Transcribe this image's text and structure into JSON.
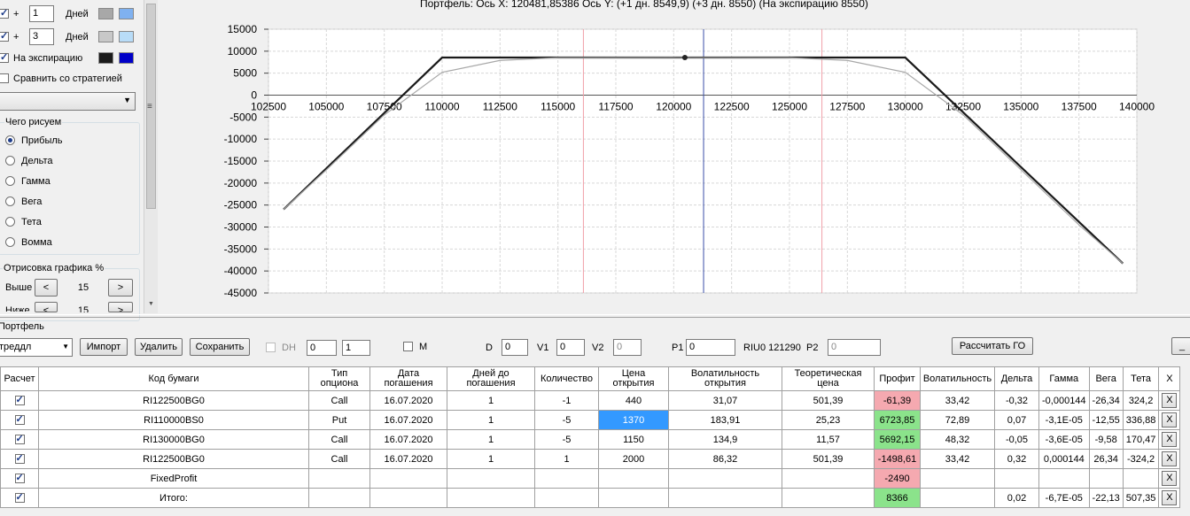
{
  "chart_title": "Портфель: Ось X: 120481,85386 Ось Y: (+1 дн. 8549,9) (+3 дн. 8550) (На экспирацию 8550)",
  "left_panel": {
    "rows": [
      {
        "prefix": "+",
        "value": "1",
        "unit": "Дней",
        "colors": [
          "#a8a8a8",
          "#7fb1f0"
        ]
      },
      {
        "prefix": "+",
        "value": "3",
        "unit": "Дней",
        "colors": [
          "#c8c8c8",
          "#b8dcf8"
        ]
      }
    ],
    "expiry_label": "На экспирацию",
    "expiry_colors": [
      "#1a1a1a",
      "#0000c8"
    ],
    "compare_label": "Сравнить со стратегией",
    "draw_group_title": "Чего рисуем",
    "draw_options": [
      "Прибыль",
      "Дельта",
      "Гамма",
      "Вега",
      "Тета",
      "Вомма"
    ],
    "selected_option": "Прибыль",
    "render_group_title": "Отрисовка графика %",
    "above_label": "Выше",
    "above_value": "15",
    "below_label": "Ниже",
    "below_value": "15",
    "prev_symbol": "<",
    "next_symbol": ">"
  },
  "portfolio": {
    "label": "Портфель",
    "strategy_value": "треддл",
    "import_label": "Импорт",
    "delete_label": "Удалить",
    "save_label": "Сохранить",
    "dh_label": "DH",
    "spin1": "0",
    "spin2": "1",
    "m_label": "M",
    "d_label": "D",
    "d_value": "0",
    "v1_label": "V1",
    "v1_value": "0",
    "v2_label": "V2",
    "v2_value": "0",
    "p1_label": "P1",
    "p1_value": "0",
    "instrument": "RIU0 121290",
    "p2_label": "P2",
    "p2_value": "0",
    "calc_go_label": "Рассчитать ГО",
    "min_label": "_"
  },
  "table": {
    "headers": [
      "Расчет",
      "Код бумаги",
      "Тип опциона",
      "Дата погашения",
      "Дней до погашения",
      "Количество",
      "Цена открытия",
      "Волатильность открытия",
      "Теоретическая цена",
      "Профит",
      "Волатильность",
      "Дельта",
      "Гамма",
      "Вега",
      "Тета",
      "X"
    ],
    "rows": [
      {
        "code": "RI122500BG0",
        "type": "Call",
        "date": "16.07.2020",
        "days": "1",
        "qty": "-1",
        "price": "440",
        "vol_open": "31,07",
        "theo": "501,39",
        "profit": "-61,39",
        "vol": "33,42",
        "delta": "-0,32",
        "gamma": "-0,000144",
        "vega": "-26,34",
        "theta": "324,2"
      },
      {
        "code": "RI110000BS0",
        "type": "Put",
        "date": "16.07.2020",
        "days": "1",
        "qty": "-5",
        "price": "1370",
        "vol_open": "183,91",
        "theo": "25,23",
        "profit": "6723,85",
        "vol": "72,89",
        "delta": "0,07",
        "gamma": "-3,1E-05",
        "vega": "-12,55",
        "theta": "336,88"
      },
      {
        "code": "RI130000BG0",
        "type": "Call",
        "date": "16.07.2020",
        "days": "1",
        "qty": "-5",
        "price": "1150",
        "vol_open": "134,9",
        "theo": "11,57",
        "profit": "5692,15",
        "vol": "48,32",
        "delta": "-0,05",
        "gamma": "-3,6E-05",
        "vega": "-9,58",
        "theta": "170,47"
      },
      {
        "code": "RI122500BG0",
        "type": "Call",
        "date": "16.07.2020",
        "days": "1",
        "qty": "1",
        "price": "2000",
        "vol_open": "86,32",
        "theo": "501,39",
        "profit": "-1498,61",
        "vol": "33,42",
        "delta": "0,32",
        "gamma": "0,000144",
        "vega": "26,34",
        "theta": "-324,2"
      }
    ],
    "fixed_label": "FixedProfit",
    "fixed_profit": "-2490",
    "total_label": "Итого:",
    "total_profit": "8366",
    "total_delta": "0,02",
    "total_gamma": "-6,7E-05",
    "total_vega": "-22,13",
    "total_theta": "507,35",
    "x_label": "X"
  },
  "chart_data": {
    "type": "line",
    "x_ticks": [
      102500,
      105000,
      107500,
      110000,
      112500,
      115000,
      117500,
      120000,
      122500,
      125000,
      127500,
      130000,
      132500,
      135000,
      137500,
      140000
    ],
    "y_ticks": [
      15000,
      10000,
      5000,
      0,
      -5000,
      -10000,
      -15000,
      -20000,
      -25000,
      -30000,
      -35000,
      -40000,
      -45000
    ],
    "xlim": [
      102500,
      140000
    ],
    "ylim": [
      -45000,
      15000
    ],
    "grid": true,
    "series": [
      {
        "color": "#1a1a1a",
        "points": [
          [
            103150,
            -26000
          ],
          [
            110000,
            8550
          ],
          [
            130000,
            8550
          ],
          [
            139400,
            -38300
          ]
        ]
      },
      {
        "color": "#a8a8a8",
        "points": [
          [
            103150,
            -26000
          ],
          [
            105000,
            -17000
          ],
          [
            107500,
            -4500
          ],
          [
            110000,
            5200
          ],
          [
            112500,
            7900
          ],
          [
            115000,
            8500
          ],
          [
            120000,
            8550
          ],
          [
            125000,
            8500
          ],
          [
            127500,
            7900
          ],
          [
            130000,
            5200
          ],
          [
            132500,
            -4500
          ],
          [
            135000,
            -17000
          ],
          [
            137500,
            -29500
          ],
          [
            139400,
            -38300
          ]
        ]
      }
    ],
    "vlines": [
      {
        "x": 116100,
        "color": "#f0a0a8"
      },
      {
        "x": 121290,
        "color": "#3a4fa8"
      },
      {
        "x": 126400,
        "color": "#f0a0a8"
      }
    ],
    "marker": {
      "x": 120482,
      "y": 8550
    }
  }
}
